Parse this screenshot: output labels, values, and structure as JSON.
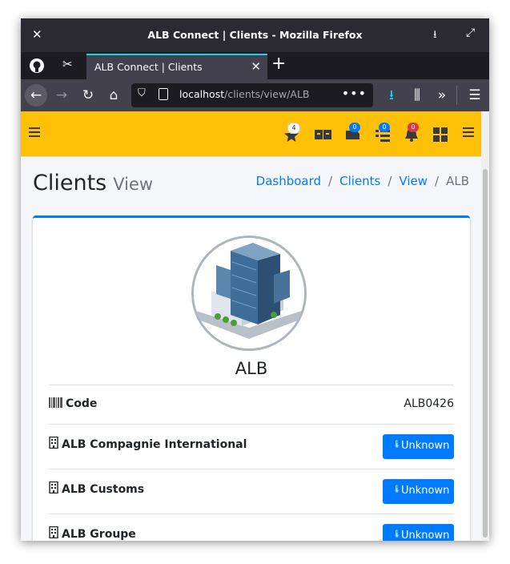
{
  "window": {
    "title": "ALB Connect | Clients - Mozilla Firefox"
  },
  "browser": {
    "tab_title": "ALB Connect | Clients",
    "url_host": "localhost",
    "url_path": "/clients/view/ALB"
  },
  "appbar": {
    "badges": {
      "rating": "4",
      "cart": "0",
      "tasks": "0",
      "alerts": "0"
    }
  },
  "page": {
    "title": "Clients",
    "subtitle": "View",
    "breadcrumbs": [
      "Dashboard",
      "Clients",
      "View",
      "ALB"
    ]
  },
  "client": {
    "name": "ALB",
    "code_label": "Code",
    "code_value": "ALB0426",
    "entities": [
      {
        "name": "ALB Compagnie International",
        "status": "Unknown"
      },
      {
        "name": "ALB Customs",
        "status": "Unknown"
      },
      {
        "name": "ALB Groupe",
        "status": "Unknown"
      }
    ]
  },
  "colors": {
    "accent": "#ffc107",
    "primary": "#007bff"
  }
}
